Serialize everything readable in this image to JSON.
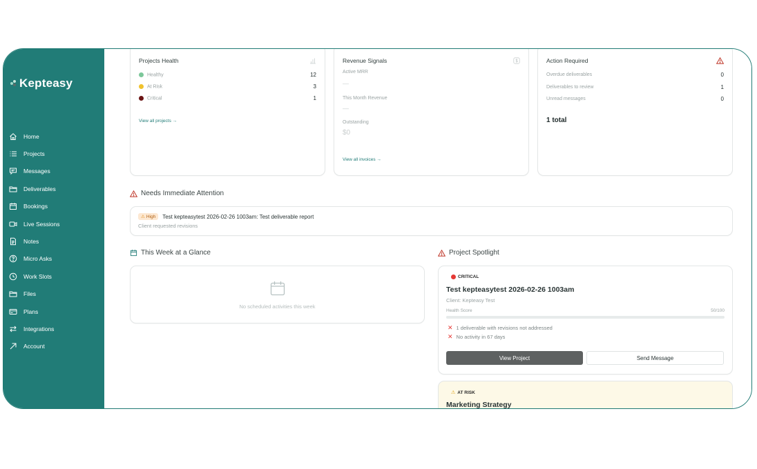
{
  "brand": {
    "name": "Kepteasy"
  },
  "sidebar": {
    "items": [
      {
        "label": "Home",
        "icon": "home-icon"
      },
      {
        "label": "Projects",
        "icon": "list-icon"
      },
      {
        "label": "Messages",
        "icon": "message-icon"
      },
      {
        "label": "Deliverables",
        "icon": "folder-icon"
      },
      {
        "label": "Bookings",
        "icon": "calendar-icon"
      },
      {
        "label": "Live Sessions",
        "icon": "video-icon"
      },
      {
        "label": "Notes",
        "icon": "note-icon"
      },
      {
        "label": "Micro Asks",
        "icon": "help-circle-icon"
      },
      {
        "label": "Work Slots",
        "icon": "clock-icon"
      },
      {
        "label": "Files",
        "icon": "folder-icon"
      },
      {
        "label": "Plans",
        "icon": "card-icon"
      },
      {
        "label": "Integrations",
        "icon": "arrows-icon"
      },
      {
        "label": "Account",
        "icon": "arrow-up-right-icon"
      }
    ]
  },
  "projects_health": {
    "title": "Projects Health",
    "rows": [
      {
        "label": "Healthy",
        "value": "12",
        "color": "#7cc79a"
      },
      {
        "label": "At Risk",
        "value": "3",
        "color": "#f0c22e"
      },
      {
        "label": "Critical",
        "value": "1",
        "color": "#6b1515"
      }
    ],
    "link": "View all projects →"
  },
  "revenue_signals": {
    "title": "Revenue Signals",
    "active_mrr_label": "Active MRR",
    "active_mrr_value": "—",
    "month_revenue_label": "This Month Revenue",
    "month_revenue_value": "—",
    "outstanding_label": "Outstanding",
    "outstanding_value": "$0",
    "link": "View all invoices →"
  },
  "action_required": {
    "title": "Action Required",
    "rows": [
      {
        "label": "Overdue deliverables",
        "value": "0"
      },
      {
        "label": "Deliverables to review",
        "value": "1"
      },
      {
        "label": "Unread messages",
        "value": "0"
      }
    ],
    "total": "1 total"
  },
  "attention": {
    "title": "Needs Immediate Attention",
    "badge": "High",
    "item_title": "Test kepteasytest 2026-02-26 1003am: Test deliverable report",
    "item_sub": "Client requested revisions"
  },
  "week": {
    "title": "This Week at a Glance",
    "empty": "No scheduled activities this week"
  },
  "spotlight": {
    "title": "Project Spotlight",
    "card1": {
      "status": "CRITICAL",
      "name": "Test kepteasytest 2026-02-26 1003am",
      "client": "Client: Kepteasy Test",
      "health_label": "Health Score",
      "health_value": "50/100",
      "health_fraction": 0.5,
      "issues": [
        "1 deliverable with revisions not addressed",
        "No activity in 67 days"
      ],
      "view_btn": "View Project",
      "msg_btn": "Send Message"
    },
    "card2": {
      "status": "AT RISK",
      "name": "Marketing Strategy"
    }
  },
  "colors": {
    "brand": "#217c77",
    "critical": "#e53935",
    "warning": "#f0a020"
  }
}
